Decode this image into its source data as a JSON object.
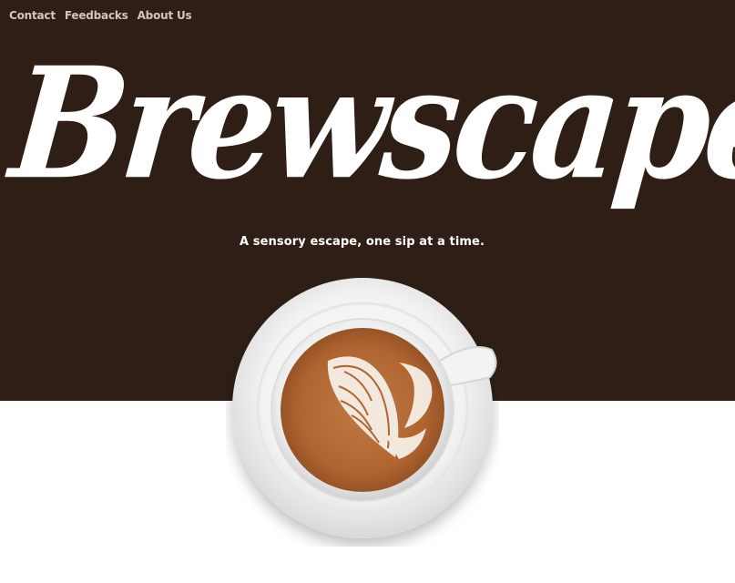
{
  "nav": {
    "items": [
      {
        "label": "Contact"
      },
      {
        "label": "Feedbacks"
      },
      {
        "label": "About Us"
      }
    ]
  },
  "hero": {
    "brand": "Brewscape",
    "tagline": "A sensory escape, one sip at a time.",
    "background_color": "#2e1e16"
  },
  "image": {
    "subject": "latte-art-coffee-cup"
  }
}
